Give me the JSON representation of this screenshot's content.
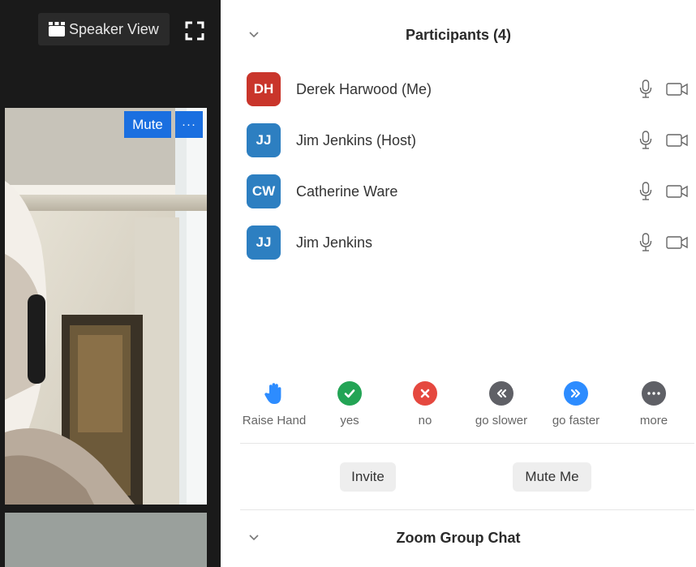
{
  "video": {
    "speaker_view_label": "Speaker View",
    "tile_mute_label": "Mute",
    "tile_more_label": "···"
  },
  "participants_panel": {
    "title": "Participants (4)",
    "participants": [
      {
        "initials": "DH",
        "name": "Derek Harwood (Me)",
        "avatar_color": "#c9352b"
      },
      {
        "initials": "JJ",
        "name": "Jim Jenkins (Host)",
        "avatar_color": "#2d7fc1"
      },
      {
        "initials": "CW",
        "name": "Catherine Ware",
        "avatar_color": "#2d7fc1"
      },
      {
        "initials": "JJ",
        "name": "Jim Jenkins",
        "avatar_color": "#2d7fc1"
      }
    ],
    "reactions": [
      {
        "label": "Raise Hand",
        "icon": "raise-hand-icon",
        "color": "#2d8cff"
      },
      {
        "label": "yes",
        "icon": "check-icon",
        "color": "#23a455"
      },
      {
        "label": "no",
        "icon": "x-icon",
        "color": "#e5483f"
      },
      {
        "label": "go slower",
        "icon": "rewind-icon",
        "color": "#5f6066"
      },
      {
        "label": "go faster",
        "icon": "fast-forward-icon",
        "color": "#2d8cff"
      },
      {
        "label": "more",
        "icon": "ellipsis-icon",
        "color": "#5f6066"
      }
    ],
    "invite_label": "Invite",
    "mute_me_label": "Mute Me"
  },
  "chat_panel": {
    "title": "Zoom Group Chat"
  }
}
